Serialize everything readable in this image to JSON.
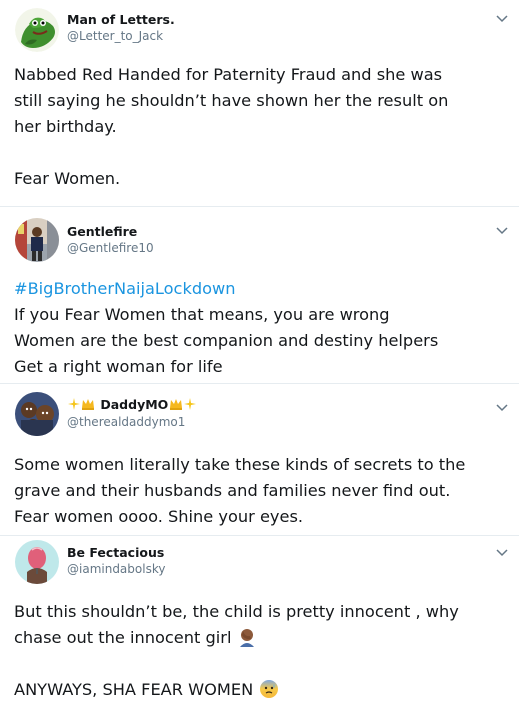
{
  "tweets": [
    {
      "name": "Man of Letters.",
      "handle": "@Letter_to_Jack",
      "lines": [
        "Nabbed Red Handed for Paternity Fraud and she was",
        "still saying he shouldn’t have shown her the result on",
        "her birthday.",
        "",
        "Fear Women."
      ]
    },
    {
      "name": "Gentlefire",
      "handle": "@Gentlefire10",
      "hashtag": "#BigBrotherNaijaLockdown",
      "lines": [
        "If you Fear Women that means, you are wrong",
        "Women are the best companion and destiny helpers",
        "Get a right woman for  life"
      ]
    },
    {
      "name": "DaddyMO",
      "name_emoji_left": [
        "sparkles-icon",
        "crown-icon"
      ],
      "name_emoji_right": [
        "crown-icon",
        "sparkles-icon"
      ],
      "handle": "@therealdaddymo1",
      "lines": [
        "Some women literally take these kinds of secrets to the",
        "grave and their husbands and families never find out.",
        "Fear women oooo. Shine your eyes."
      ]
    },
    {
      "name": "Be Fectacious",
      "handle": "@iamindabolsky",
      "lines": [
        "But this shouldn’t be, the child is pretty innocent , why",
        "chase out the innocent girl",
        "",
        "ANYWAYS, SHA FEAR WOMEN"
      ],
      "line2_emoji": "man-facepalming-icon",
      "line4_emoji": "anxious-face-icon"
    }
  ],
  "colors": {
    "text": "#14171a",
    "secondary": "#657786",
    "link": "#1b95e0",
    "divider": "#e6ecf0"
  }
}
